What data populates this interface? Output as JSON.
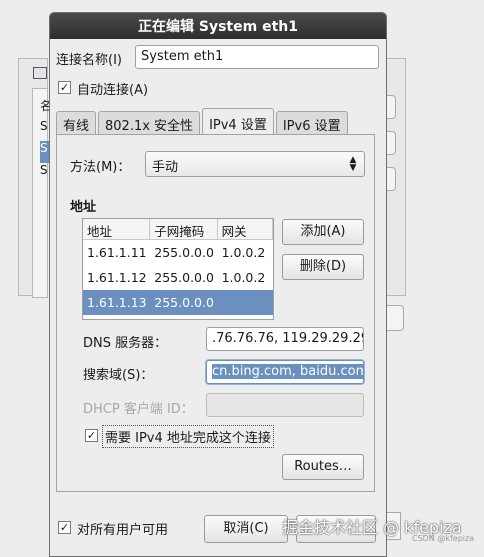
{
  "dialog": {
    "title": "正在编辑 System eth1",
    "connection_name_label": "连接名称(I)",
    "connection_name_value": "System eth1",
    "auto_connect_label": "自动连接(A)",
    "auto_connect_checked": true
  },
  "tabs": [
    {
      "label": "有线",
      "active": false
    },
    {
      "label": "802.1x 安全性",
      "active": false
    },
    {
      "label": "IPv4 设置",
      "active": true
    },
    {
      "label": "IPv6 设置",
      "active": false
    }
  ],
  "ipv4": {
    "method_label": "方法(M)：",
    "method_value": "手动",
    "address_section_title": "地址",
    "columns": [
      "地址",
      "子网掩码",
      "网关"
    ],
    "rows": [
      [
        "1.61.1.11",
        "255.0.0.0",
        "1.0.0.2"
      ],
      [
        "1.61.1.12",
        "255.0.0.0",
        "1.0.0.2"
      ],
      [
        "1.61.1.13",
        "255.0.0.0",
        ""
      ]
    ],
    "selected_row": 2,
    "add_button": "添加(A)",
    "delete_button": "删除(D)",
    "dns_label": "DNS 服务器：",
    "dns_value": ".76.76.76, 119.29.29.29",
    "search_label": "搜索域(S)：",
    "search_value": "cn.bing.com, baidu.com",
    "dhcp_label": "DHCP 客户端 ID：",
    "dhcp_value": "",
    "require_ipv4_label": "需要 IPv4 地址完成这个连接",
    "require_ipv4_checked": true,
    "routes_button": "Routes…"
  },
  "footer": {
    "all_users_label": "对所有用户可用",
    "all_users_checked": true,
    "cancel_button": "取消(C)"
  },
  "background": {
    "rows": [
      "名",
      "S",
      "S",
      "S"
    ]
  },
  "watermark": {
    "main": "掘金技术社区 @ kfepiza",
    "sub": "CSDN @kfepiza"
  }
}
